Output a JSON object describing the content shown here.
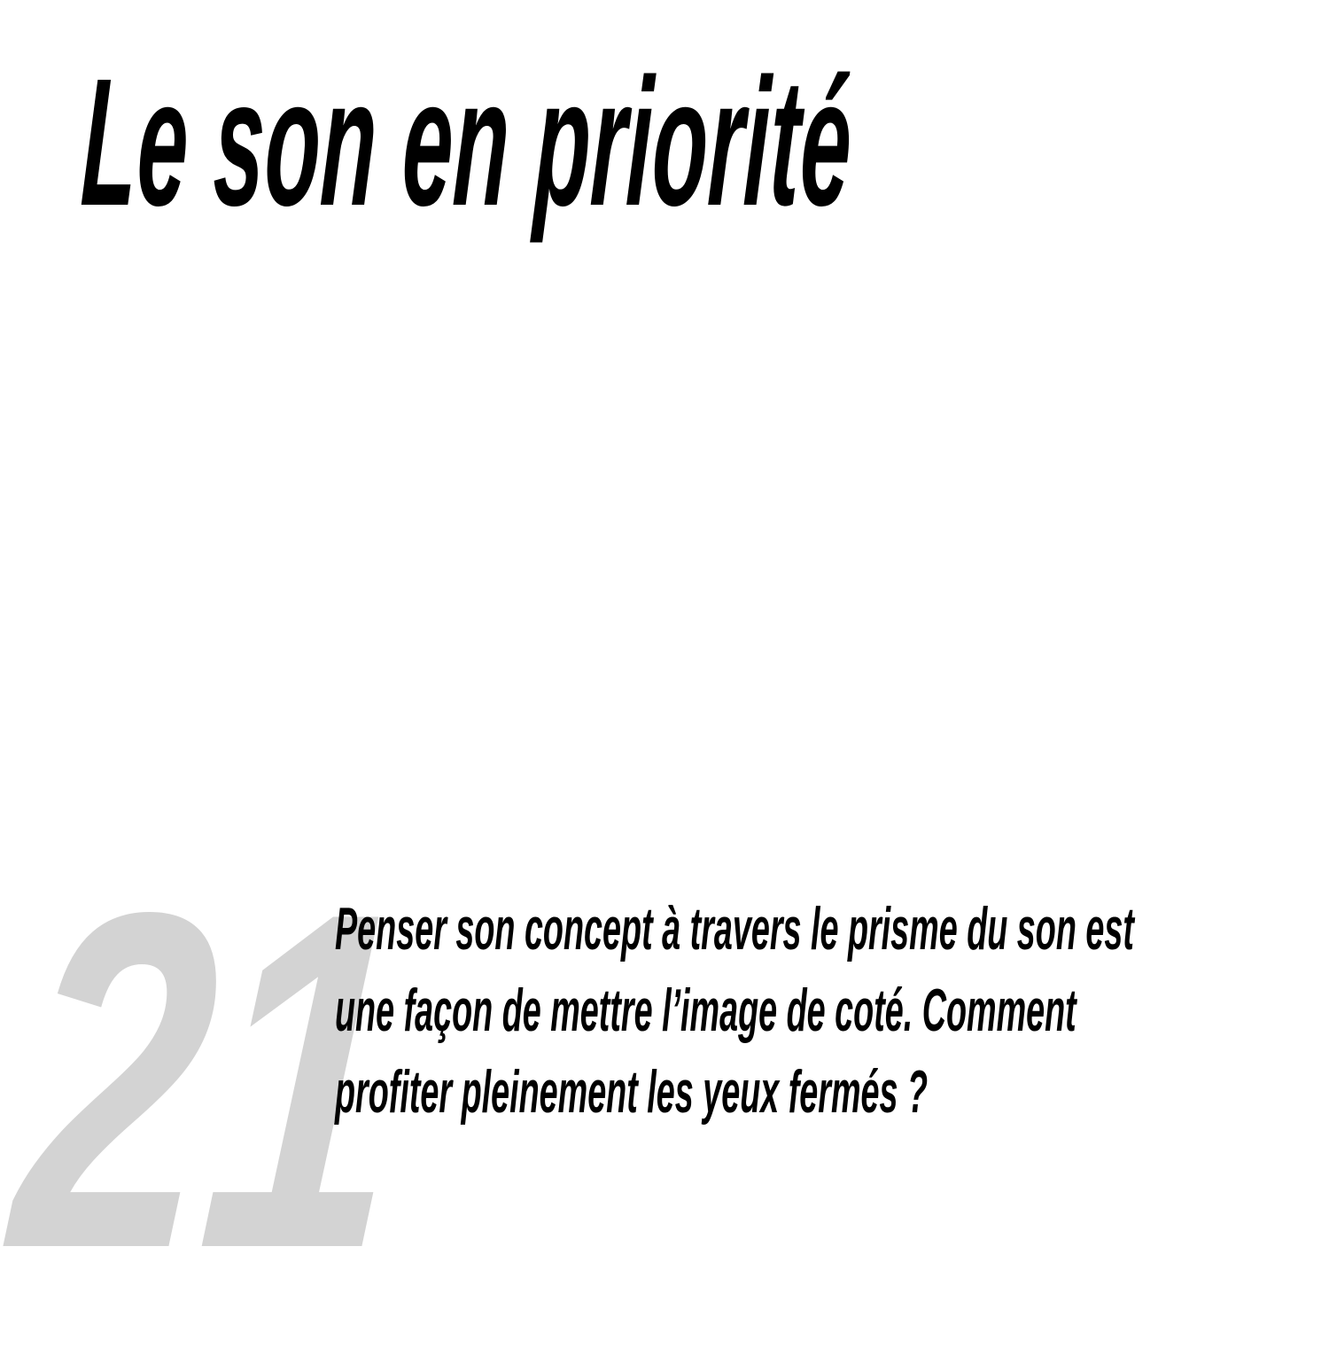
{
  "page": {
    "title": "Le son en priorité",
    "number": "21",
    "paragraph_lines": [
      "Penser son concept à travers le prisme du son est",
      "une façon de mettre l’image de coté. Comment",
      "profiter pleinement les yeux fermés ?"
    ]
  },
  "colors": {
    "text": "#000000",
    "number": "#d3d3d3",
    "background": "#ffffff"
  }
}
